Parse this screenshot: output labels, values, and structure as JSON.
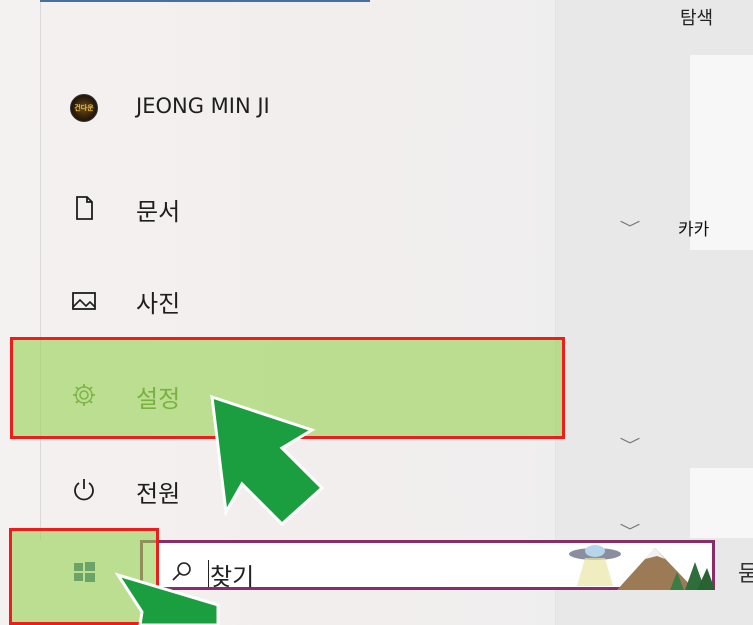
{
  "start_menu": {
    "user": {
      "name": "JEONG MIN JI",
      "avatar_text": "건다운"
    },
    "items": [
      {
        "label": "문서",
        "icon": "document-icon"
      },
      {
        "label": "사진",
        "icon": "pictures-icon"
      },
      {
        "label": "설정",
        "icon": "gear-icon"
      },
      {
        "label": "전원",
        "icon": "power-icon"
      }
    ]
  },
  "right_pane": {
    "group_label": "탐색",
    "tile_label": "카카",
    "edge_char": "묻"
  },
  "taskbar": {
    "search_text": "찾기",
    "start_icon": "windows-logo-icon",
    "search_icon": "search-icon"
  },
  "annotations": {
    "highlight_color": "#96d250",
    "border_color": "#ef1c1c",
    "arrow_color": "#1a9e3f"
  }
}
